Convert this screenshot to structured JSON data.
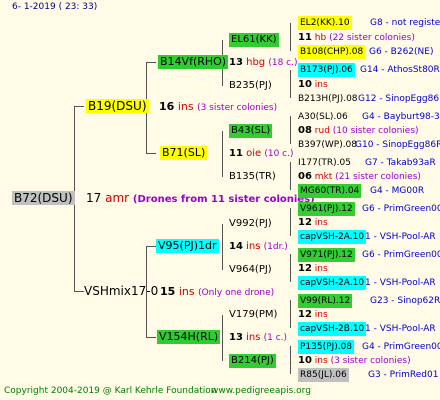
{
  "header": {
    "date": "6-  1-2019  ( 23: 33)"
  },
  "root": {
    "label": "B72(DSU)"
  },
  "root_info": {
    "num": "17",
    "abbr": "amr",
    "note": "(Drones from 11 sister colonies)"
  },
  "g1": {
    "father": {
      "label": "B19(DSU)",
      "num": "16",
      "abbr": "ins",
      "note": "(3 sister colonies)"
    },
    "mother": {
      "label": "VSHmix17-0",
      "num": "15",
      "abbr": "ins",
      "note": "(Only one drone)"
    }
  },
  "g2": [
    {
      "label": "B14Vf(RHO)",
      "num": "13",
      "abbr": "hbg",
      "note": "(18 c.)"
    },
    {
      "label": "B71(SL)",
      "num": "11",
      "abbr": "oie",
      "note": "(10 c.)"
    },
    {
      "label": "V95(PJ)1dr",
      "num": "14",
      "abbr": "ins",
      "note": "(1dr.)"
    },
    {
      "label": "V154H(RL)",
      "num": "13",
      "abbr": "ins",
      "note": "(1 c.)"
    }
  ],
  "g3": [
    {
      "label": "EL61(KK)"
    },
    {
      "label": "B235(PJ)"
    },
    {
      "label": "B43(SL)"
    },
    {
      "label": "B135(TR)"
    },
    {
      "label": "V992(PJ)"
    },
    {
      "label": "V964(PJ)"
    },
    {
      "label": "V179(PM)"
    },
    {
      "label": "B214(PJ)"
    }
  ],
  "g4": [
    {
      "label": "EL2(KK).10",
      "right": "G8 - not registe"
    },
    {
      "num": "11",
      "abbr": "hb",
      "note": "(22 sister colonies)"
    },
    {
      "label": "B108(CHP).08",
      "right": "G6 - B262(NE)"
    },
    {
      "label": "B173(PJ).06",
      "right": "G14 - AthosSt80R"
    },
    {
      "num": "10",
      "abbr": "ins"
    },
    {
      "label": "B213H(PJ).08",
      "right": "G12 - SinopEgg86R"
    },
    {
      "label": "A30(SL).06",
      "right": "G4 - Bayburt98-3"
    },
    {
      "num": "08",
      "abbr": "rud",
      "note": "(10 sister colonies)"
    },
    {
      "label": "B397(WP).08",
      "right": "G10 - SinopEgg86R"
    },
    {
      "label": "I177(TR).05",
      "right": "G7 - Takab93aR"
    },
    {
      "num": "06",
      "abbr": "mkt",
      "note": "(21 sister colonies)"
    },
    {
      "label": "MG60(TR).04",
      "right": "G4 - MG00R"
    },
    {
      "label": "V961(PJ).12",
      "right": "G6 - PrimGreen00"
    },
    {
      "num": "12",
      "abbr": "ins"
    },
    {
      "label": "capVSH-2A.10",
      "right": "1 - VSH-Pool-AR"
    },
    {
      "label": "V971(PJ).12",
      "right": "G6 - PrimGreen00"
    },
    {
      "num": "12",
      "abbr": "ins"
    },
    {
      "label": "capVSH-2A.10",
      "right": "1 - VSH-Pool-AR"
    },
    {
      "label": "V99(RL).12",
      "right": "G23 - Sinop62R"
    },
    {
      "num": "12",
      "abbr": "ins"
    },
    {
      "label": "capVSH-2B.10",
      "right": "1 - VSH-Pool-AR"
    },
    {
      "label": "P135(PJ).08",
      "right": "G4 - PrimGreen00"
    },
    {
      "num": "10",
      "abbr": "ins",
      "note": "(3 sister colonies)"
    },
    {
      "label": "R85(JL).06",
      "right": "G3 - PrimRed01"
    }
  ],
  "footer": {
    "copyright": "Copyright 2004-2019 @ Karl Kehrle Foundation",
    "site": "www.pedigreeapis.org"
  },
  "colors": {
    "background": "#fffbe6",
    "yellow": "#ffff00",
    "green": "#2ecc2e",
    "cyan": "#00ffff",
    "gray": "#c0c0c0"
  }
}
